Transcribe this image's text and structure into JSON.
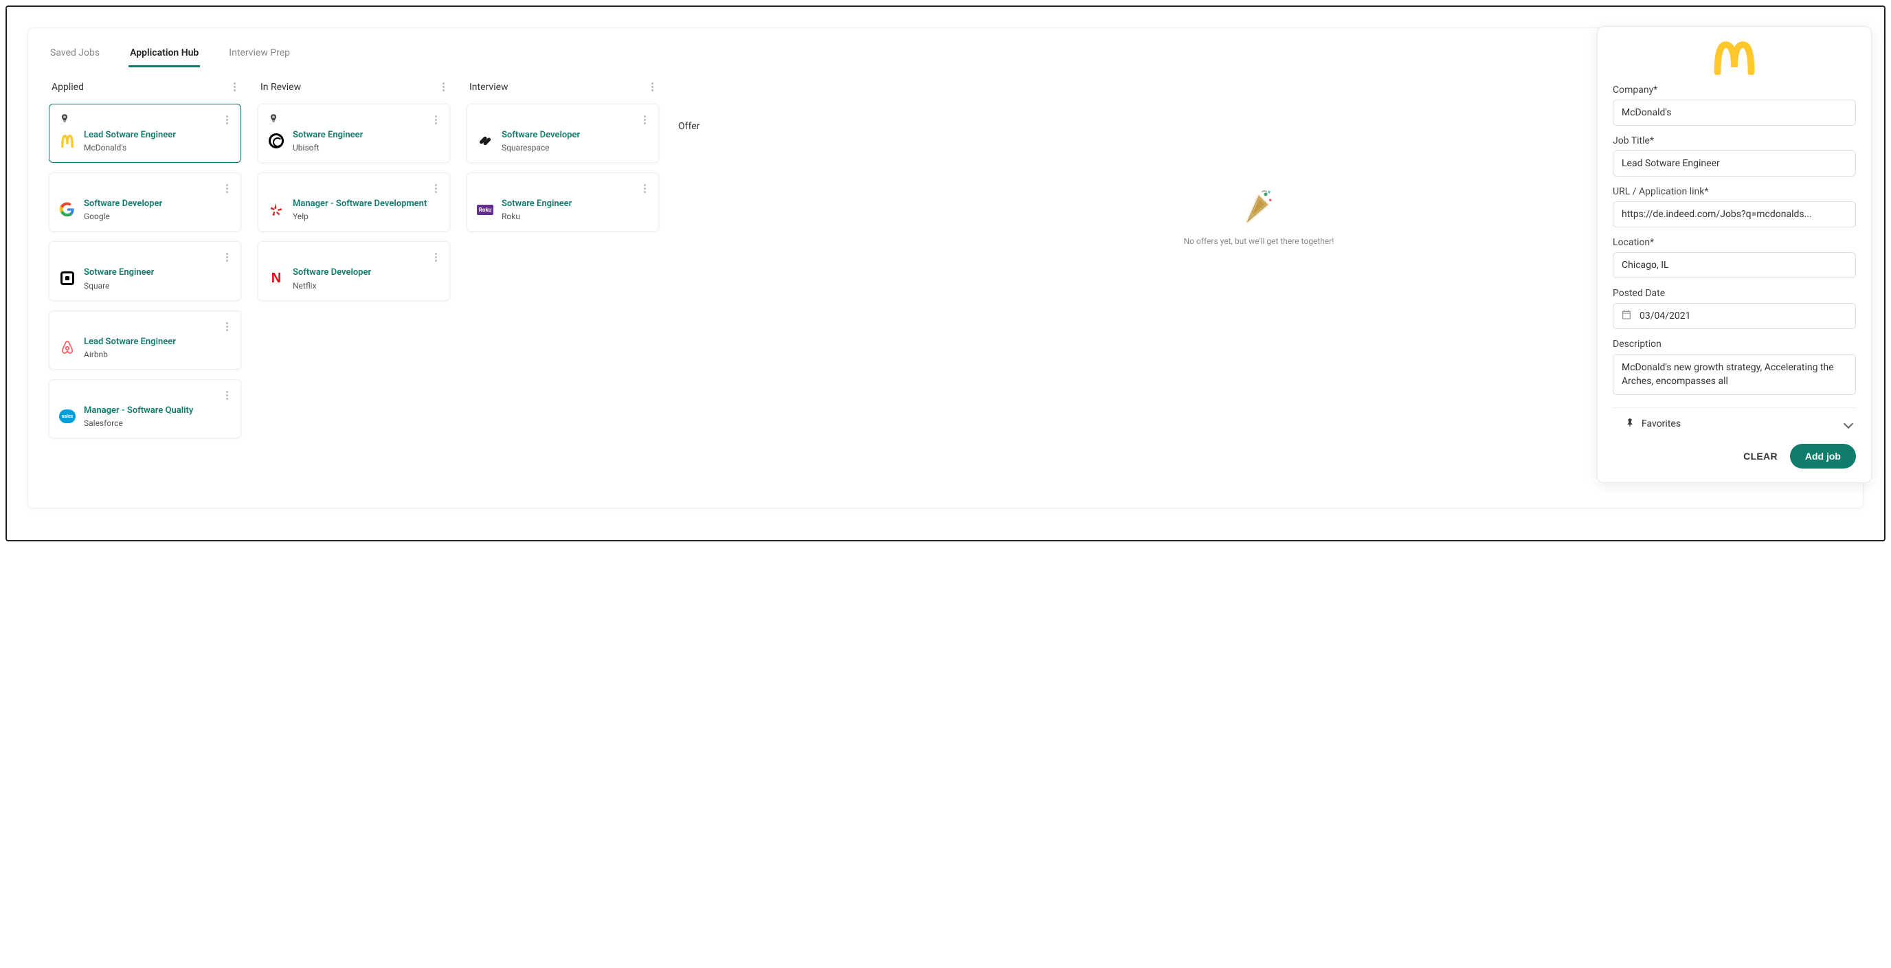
{
  "tabs": {
    "saved_jobs": "Saved Jobs",
    "application_hub": "Application Hub",
    "interview_prep": "Interview Prep"
  },
  "columns": {
    "applied": {
      "title": "Applied"
    },
    "in_review": {
      "title": "In Review"
    },
    "interview": {
      "title": "Interview"
    },
    "offer": {
      "title": "Offer"
    }
  },
  "cards": {
    "applied": [
      {
        "title": "Lead Sotware Engineer",
        "company": "McDonald's",
        "badge": true
      },
      {
        "title": "Software Developer",
        "company": "Google",
        "badge": false
      },
      {
        "title": "Sotware Engineer",
        "company": "Square",
        "badge": false
      },
      {
        "title": "Lead Sotware Engineer",
        "company": "Airbnb",
        "badge": false
      },
      {
        "title": "Manager - Software Quality",
        "company": "Salesforce",
        "badge": false
      }
    ],
    "in_review": [
      {
        "title": "Sotware Engineer",
        "company": "Ubisoft",
        "badge": true
      },
      {
        "title": "Manager - Software Development",
        "company": "Yelp",
        "badge": false
      },
      {
        "title": "Software Developer",
        "company": "Netflix",
        "badge": false
      }
    ],
    "interview": [
      {
        "title": "Software Developer",
        "company": "Squarespace",
        "badge": false
      },
      {
        "title": "Sotware Engineer",
        "company": "Roku",
        "badge": false
      }
    ]
  },
  "offer_empty": "No offers yet, but we'll get there together!",
  "panel": {
    "company_label": "Company*",
    "company_value": "McDonald's",
    "jobtitle_label": "Job Title*",
    "jobtitle_value": "Lead Sotware Engineer",
    "url_label": "URL / Application link*",
    "url_value": "https://de.indeed.com/Jobs?q=mcdonalds...",
    "location_label": "Location*",
    "location_value": "Chicago, IL",
    "posted_label": "Posted Date",
    "posted_value": "03/04/2021",
    "desc_label": "Description",
    "desc_value": "McDonald's new growth strategy, Accelerating the Arches, encompasses all",
    "favorites_label": "Favorites",
    "clear_label": "CLEAR",
    "add_label": "Add job"
  }
}
